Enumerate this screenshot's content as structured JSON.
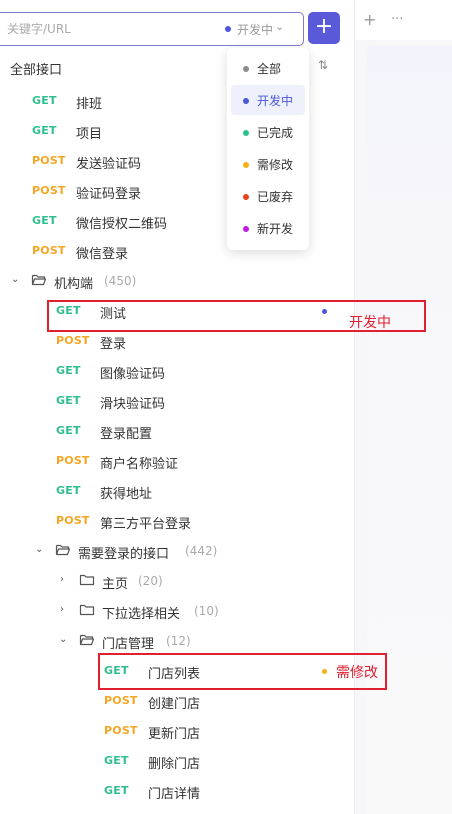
{
  "search": {
    "placeholder": "关键字/URL",
    "status_value": "开发中"
  },
  "tree": {
    "root_label": "全部接口",
    "top_items": [
      {
        "method": "GET",
        "name": "排班"
      },
      {
        "method": "GET",
        "name": "项目"
      },
      {
        "method": "POST",
        "name": "发送验证码"
      },
      {
        "method": "POST",
        "name": "验证码登录"
      },
      {
        "method": "GET",
        "name": "微信授权二维码"
      },
      {
        "method": "POST",
        "name": "微信登录"
      }
    ],
    "org_folder": {
      "name": "机构端",
      "count": "(450)"
    },
    "org_items": [
      {
        "method": "GET",
        "name": "测试"
      },
      {
        "method": "POST",
        "name": "登录"
      },
      {
        "method": "GET",
        "name": "图像验证码"
      },
      {
        "method": "GET",
        "name": "滑块验证码"
      },
      {
        "method": "GET",
        "name": "登录配置"
      },
      {
        "method": "POST",
        "name": "商户名称验证"
      },
      {
        "method": "GET",
        "name": "获得地址"
      },
      {
        "method": "POST",
        "name": "第三方平台登录"
      }
    ],
    "auth_folder": {
      "name": "需要登录的接口",
      "count": "(442)"
    },
    "home_folder": {
      "name": "主页",
      "count": "(20)"
    },
    "dropdown_folder": {
      "name": "下拉选择相关",
      "count": "(10)"
    },
    "store_folder": {
      "name": "门店管理",
      "count": "(12)"
    },
    "store_items": [
      {
        "method": "GET",
        "name": "门店列表"
      },
      {
        "method": "POST",
        "name": "创建门店"
      },
      {
        "method": "POST",
        "name": "更新门店"
      },
      {
        "method": "GET",
        "name": "删除门店"
      },
      {
        "method": "GET",
        "name": "门店详情"
      }
    ]
  },
  "status_menu": {
    "items": [
      {
        "label": "全部",
        "color": "#8c8c8c"
      },
      {
        "label": "开发中",
        "color": "#4b57d8"
      },
      {
        "label": "已完成",
        "color": "#2fbf8f"
      },
      {
        "label": "需修改",
        "color": "#f5b014"
      },
      {
        "label": "已废弃",
        "color": "#e8431c"
      },
      {
        "label": "新开发",
        "color": "#c21ee0"
      }
    ]
  },
  "annotations": [
    {
      "label": "开发中",
      "dot_color": "#4b57d8"
    },
    {
      "label": "需修改",
      "dot_color": "#f5b014"
    }
  ],
  "colors": {
    "accent": "#5a5ad8",
    "get": "#2fbf8f",
    "post": "#f5a623",
    "highlight": "#e01f2f"
  }
}
